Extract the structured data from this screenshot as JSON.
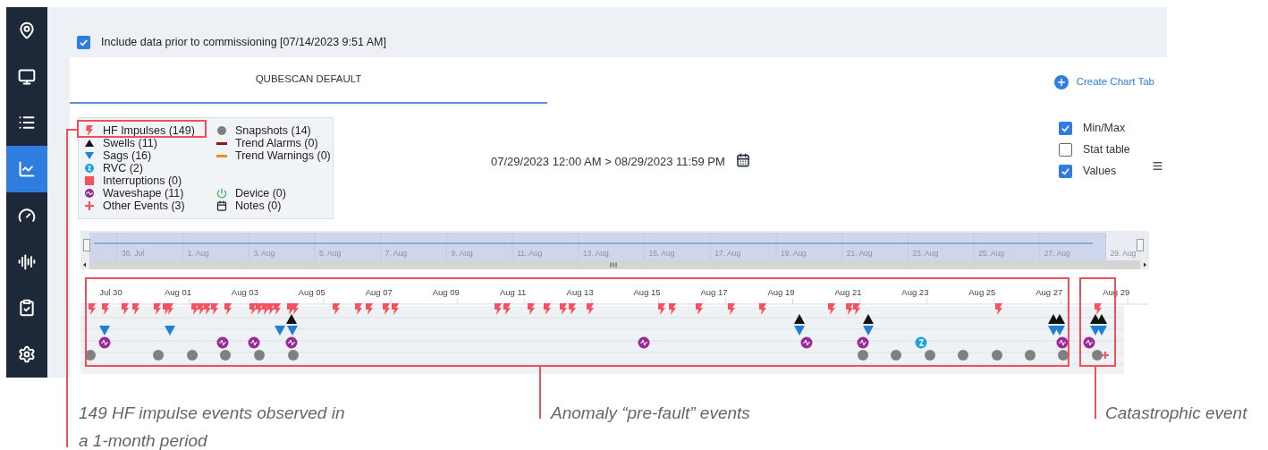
{
  "sidebar": {
    "items": [
      {
        "selected": false
      },
      {
        "selected": false
      },
      {
        "selected": false
      },
      {
        "selected": true
      },
      {
        "selected": false
      },
      {
        "selected": false
      },
      {
        "selected": false
      },
      {
        "selected": false
      }
    ]
  },
  "include_prior": {
    "label": "Include data prior to commissioning [07/14/2023 9:51 AM]",
    "checked": true
  },
  "tabs": [
    {
      "label": "QUBESCAN DEFAULT",
      "selected": true
    }
  ],
  "create_tab": "Create Chart Tab",
  "legend": {
    "left": [
      {
        "kind": "impulse",
        "label": "HF Impulses (149)"
      },
      {
        "kind": "swell",
        "label": "Swells (11)"
      },
      {
        "kind": "sag",
        "label": "Sags (16)"
      },
      {
        "kind": "rvc",
        "label": "RVC (2)"
      },
      {
        "kind": "interruption",
        "label": "Interruptions (0)"
      },
      {
        "kind": "waveshape",
        "label": "Waveshape (11)"
      },
      {
        "kind": "other",
        "label": "Other Events (3)"
      }
    ],
    "right_top": [
      {
        "kind": "snapshot",
        "label": "Snapshots (14)"
      },
      {
        "kind": "alarm",
        "label": "Trend Alarms (0)"
      },
      {
        "kind": "warning",
        "label": "Trend Warnings (0)"
      }
    ],
    "right_bottom": [
      {
        "kind": "device",
        "label": "Device (0)"
      },
      {
        "kind": "notes",
        "label": "Notes (0)"
      }
    ]
  },
  "date_range": "07/29/2023 12:00 AM > 08/29/2023 11:59 PM",
  "options": [
    {
      "label": "Min/Max",
      "checked": true
    },
    {
      "label": "Stat table",
      "checked": false
    },
    {
      "label": "Values",
      "checked": true
    }
  ],
  "navigator": {
    "ticks": [
      "30. Jul",
      "1. Aug",
      "3. Aug",
      "5. Aug",
      "7. Aug",
      "9. Aug",
      "11. Aug",
      "13. Aug",
      "15. Aug",
      "17. Aug",
      "19. Aug",
      "21. Aug",
      "23. Aug",
      "25. Aug",
      "27. Aug",
      "29. Aug"
    ]
  },
  "timeline": {
    "ticks": [
      "Jul 30",
      "Aug 01",
      "Aug 03",
      "Aug 05",
      "Aug 07",
      "Aug 09",
      "Aug 11",
      "Aug 13",
      "Aug 15",
      "Aug 17",
      "Aug 19",
      "Aug 21",
      "Aug 23",
      "Aug 25",
      "Aug 27",
      "Aug 29"
    ]
  },
  "annotations": [
    {
      "text": "149 HF impulse events observed in a 1-month period"
    },
    {
      "text": "Anomaly “pre-fault” events"
    },
    {
      "text": "Catastrophic event"
    }
  ]
}
